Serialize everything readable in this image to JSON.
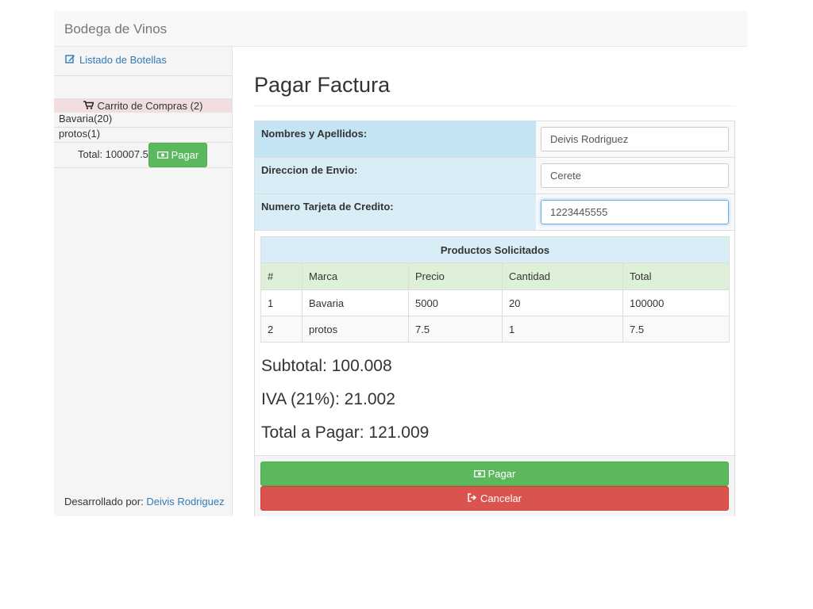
{
  "navbar": {
    "brand": "Bodega de Vinos"
  },
  "sidebar": {
    "link_label": "Listado de Botellas",
    "cart": {
      "title": "Carrito de Compras (2)",
      "items": [
        "Bavaria(20)",
        "protos(1)"
      ],
      "total_text": "Total: 100007.5",
      "pay_label": "Pagar"
    },
    "footer_prefix": "Desarrollado por:",
    "footer_author": "Deivis Rodriguez"
  },
  "page": {
    "title": "Pagar Factura"
  },
  "form": {
    "fields": [
      {
        "label": "Nombres y Apellidos:",
        "value": "Deivis Rodriguez"
      },
      {
        "label": "Direccion de Envio:",
        "value": "Cerete"
      },
      {
        "label": "Numero Tarjeta de Credito:",
        "value": "1223445555"
      }
    ]
  },
  "products": {
    "title": "Productos Solicitados",
    "headers": [
      "#",
      "Marca",
      "Precio",
      "Cantidad",
      "Total"
    ],
    "rows": [
      [
        "1",
        "Bavaria",
        "5000",
        "20",
        "100000"
      ],
      [
        "2",
        "protos",
        "7.5",
        "1",
        "7.5"
      ]
    ]
  },
  "summary": {
    "subtotal": "Subtotal: 100.008",
    "iva": "IVA (21%): 21.002",
    "total": "Total a Pagar: 121.009"
  },
  "actions": {
    "pay_label": "Pagar",
    "cancel_label": "Cancelar"
  },
  "colors": {
    "success": "#5cb85c",
    "danger": "#d9534f",
    "link": "#337ab7",
    "info_bg": "#d9edf7",
    "success_bg": "#dff0d8",
    "danger_bg": "#f2dede"
  },
  "icons": {
    "edit": "edit-icon",
    "cart": "shopping-cart-icon",
    "money": "money-icon",
    "logout": "sign-out-icon"
  }
}
